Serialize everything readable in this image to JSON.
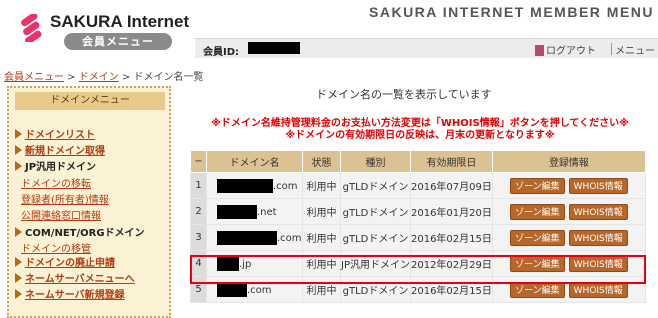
{
  "header": {
    "logo_title": "SAKURA Internet",
    "logo_sub": "会員メニュー",
    "member_menu_title": "SAKURA INTERNET MEMBER MENU",
    "member_id_label": "会員ID:",
    "logout_label": "ログアウト",
    "menu_label": "メニュー"
  },
  "breadcrumb": {
    "items": [
      "会員メニュー",
      "ドメイン"
    ],
    "current": "ドメイン名一覧",
    "separator": " > "
  },
  "sidebar": {
    "heading": "ドメインメニュー",
    "items": [
      {
        "label": "ドメインリスト",
        "style": "link"
      },
      {
        "label": "新規ドメイン取得",
        "style": "link"
      },
      {
        "label": "JP汎用ドメイン",
        "style": "bold"
      },
      {
        "label": "ドメインの移転",
        "style": "sub"
      },
      {
        "label": "登録者(所有者)情報",
        "style": "sub"
      },
      {
        "label": "公開連絡窓口情報",
        "style": "sub"
      },
      {
        "label": "COM/NET/ORGドメイン",
        "style": "bold"
      },
      {
        "label": "ドメインの移管",
        "style": "sub"
      },
      {
        "label": "ドメインの廃止申請",
        "style": "link"
      },
      {
        "label": "ネームサーバメニューへ",
        "style": "link"
      },
      {
        "label": "ネームサーバ新規登録",
        "style": "link"
      }
    ]
  },
  "main": {
    "title": "ドメイン名の一覧を表示しています",
    "note1": "※ドメイン名維持管理料金のお支払い方法変更は「WHOIS情報」ボタンを押してください※",
    "note2": "※ドメインの有効期限日の反映は、月末の更新となります※"
  },
  "table": {
    "headers": [
      "−",
      "ドメイン名",
      "状態",
      "種別",
      "有効期限日",
      "登録情報"
    ],
    "rows": [
      {
        "num": "1",
        "suffix": ".com",
        "status": "利用中",
        "type": "gTLDドメイン",
        "expiry": "2016年07月09日"
      },
      {
        "num": "2",
        "suffix": ".net",
        "status": "利用中",
        "type": "gTLDドメイン",
        "expiry": "2016年01月20日"
      },
      {
        "num": "3",
        "suffix": ".com",
        "status": "利用中",
        "type": "gTLDドメイン",
        "expiry": "2016年02月15日"
      },
      {
        "num": "4",
        "suffix": ".jp",
        "status": "利用中",
        "type": "JP汎用ドメイン",
        "expiry": "2012年02月29日"
      },
      {
        "num": "5",
        "suffix": ".com",
        "status": "利用中",
        "type": "gTLDドメイン",
        "expiry": "2016年02月15日"
      }
    ],
    "zone_button_label": "ゾーン編集",
    "whois_button_label": "WHOIS情報"
  },
  "colors": {
    "accent": "#b7672a",
    "highlight": "#e60012",
    "note": "#e60000",
    "sidebar_bg": "#fbf1d4",
    "table_header": "#dcc193"
  }
}
